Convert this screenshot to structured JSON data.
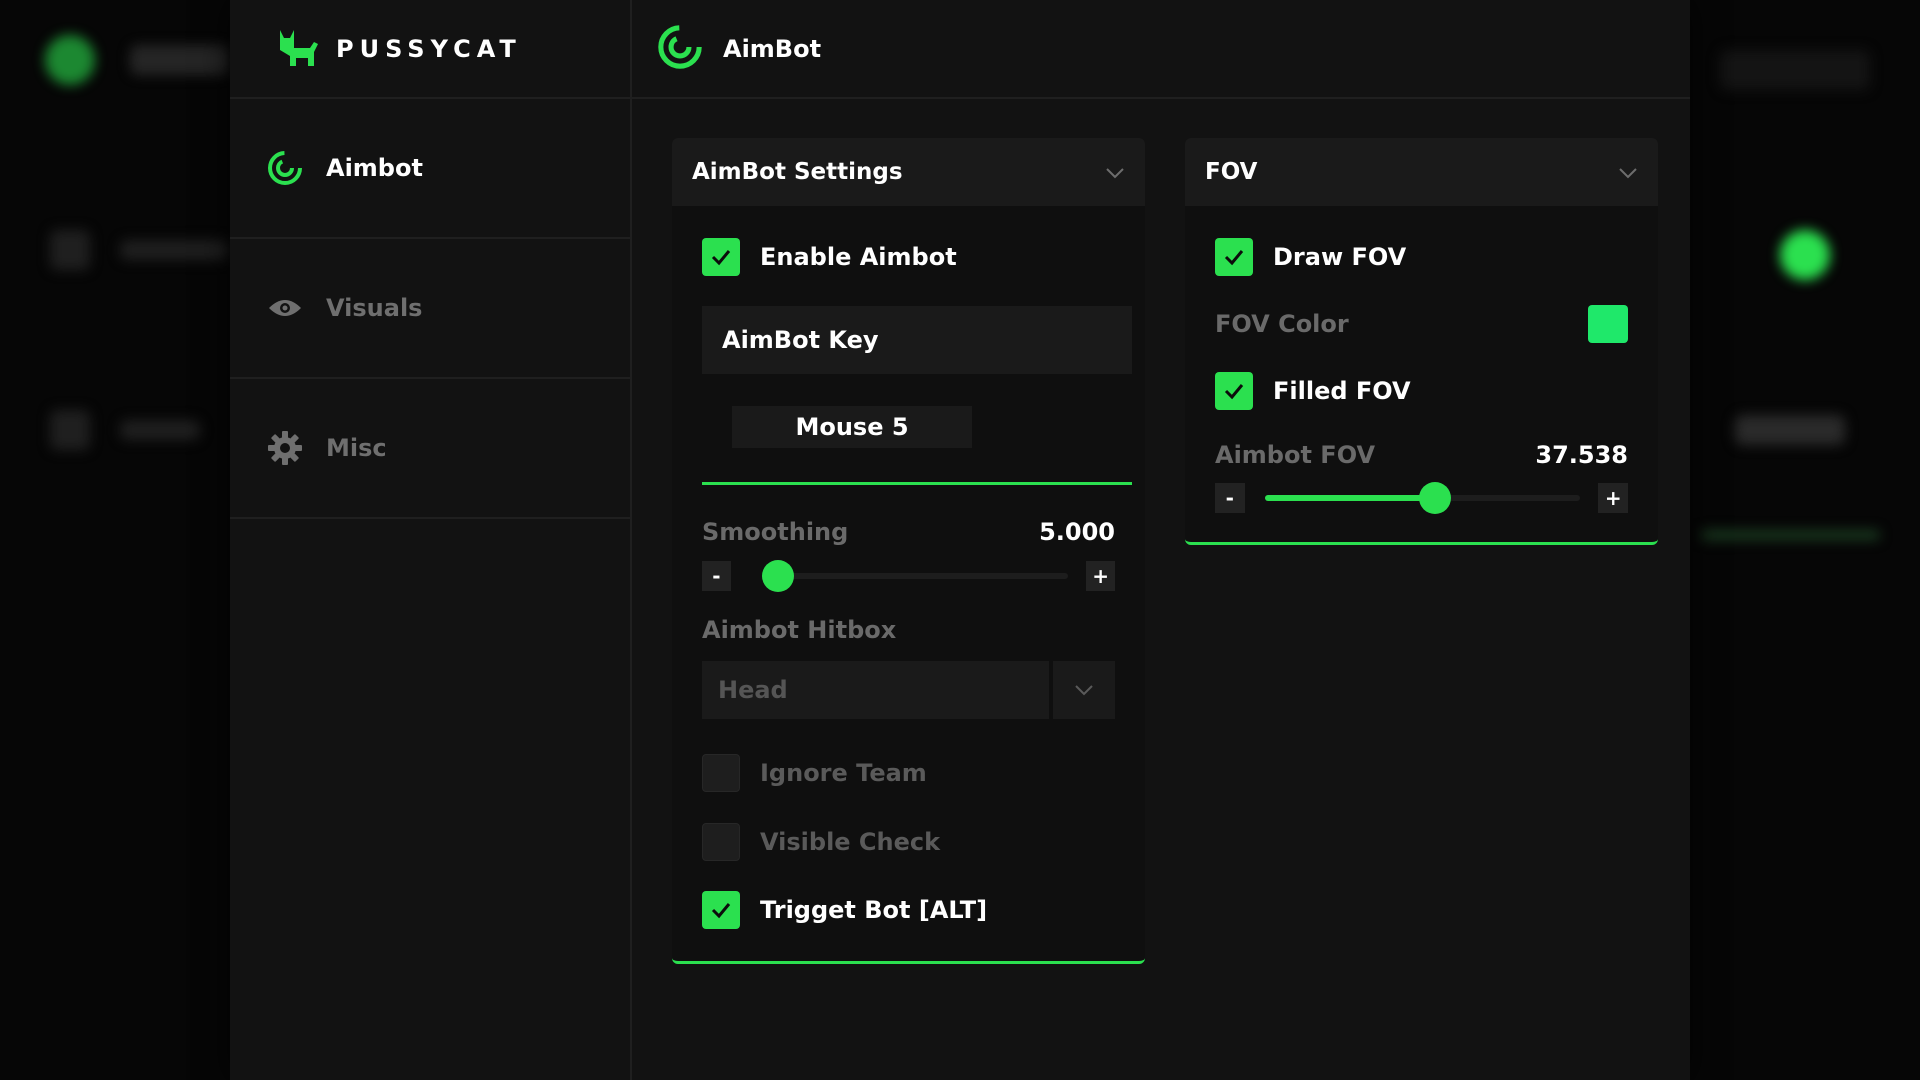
{
  "app": {
    "brand": "PUSSYCAT",
    "page_title": "AimBot",
    "accent_color": "#2be04f",
    "swatch_color": "#1fe86a"
  },
  "sidebar": {
    "items": [
      {
        "label": "Aimbot",
        "icon": "aimbot-radar-icon",
        "active": true
      },
      {
        "label": "Visuals",
        "icon": "eye-icon",
        "active": false
      },
      {
        "label": "Misc",
        "icon": "gear-icon",
        "active": false
      }
    ]
  },
  "aimbot_panel": {
    "title": "AimBot Settings",
    "enable_aimbot": {
      "label": "Enable Aimbot",
      "checked": true
    },
    "aimbot_key": {
      "label": "AimBot Key",
      "value": "Mouse 5"
    },
    "smoothing": {
      "label": "Smoothing",
      "value": "5.000",
      "fraction": 0.05,
      "minus": "-",
      "plus": "+"
    },
    "hitbox": {
      "label": "Aimbot Hitbox",
      "value": "Head"
    },
    "ignore_team": {
      "label": "Ignore Team",
      "checked": false
    },
    "visible_check": {
      "label": "Visible Check",
      "checked": false
    },
    "trigger_bot": {
      "label": "Trigget Bot [ALT]",
      "checked": true
    }
  },
  "fov_panel": {
    "title": "FOV",
    "draw_fov": {
      "label": "Draw FOV",
      "checked": true
    },
    "fov_color": {
      "label": "FOV Color"
    },
    "filled_fov": {
      "label": "Filled FOV",
      "checked": true
    },
    "aimbot_fov": {
      "label": "Aimbot FOV",
      "value": "37.538",
      "fraction": 0.54,
      "minus": "-",
      "plus": "+"
    }
  }
}
